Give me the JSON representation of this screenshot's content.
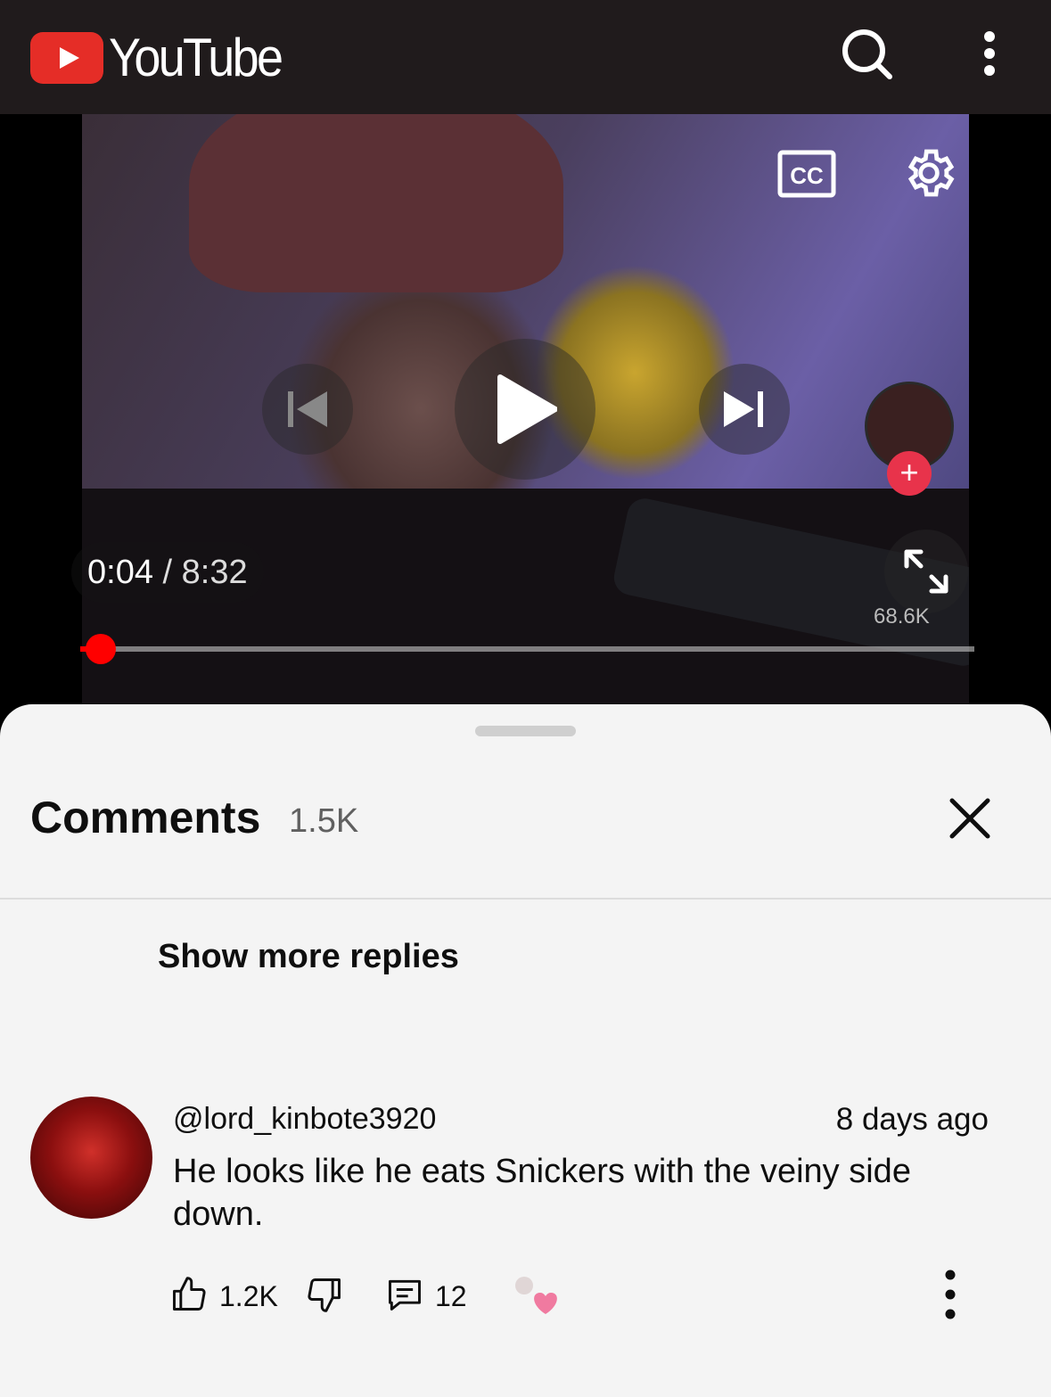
{
  "app": {
    "name": "YouTube"
  },
  "player": {
    "current_time": "0:04",
    "separator": " / ",
    "duration": "8:32",
    "progress": 0.008,
    "overlay_count": "68.6K"
  },
  "comments_panel": {
    "title": "Comments",
    "count": "1.5K",
    "show_more_label": "Show more replies"
  },
  "comment": {
    "author": "@lord_kinbote3920",
    "time_ago": "8 days ago",
    "text": "He looks like he eats Snickers with the veiny side down.",
    "likes": "1.2K",
    "replies": "12"
  },
  "icons": [
    "youtube-logo",
    "search-icon",
    "more-vert-icon",
    "cc-icon",
    "settings-icon",
    "previous-icon",
    "play-icon",
    "next-icon",
    "fullscreen-icon",
    "close-icon",
    "like-icon",
    "dislike-icon",
    "reply-icon",
    "creator-heart-icon"
  ],
  "colors": {
    "brand_red": "#e52d27",
    "topbar": "#201b1c",
    "sheet_bg": "#f4f4f4",
    "progress": "#ff0000"
  }
}
